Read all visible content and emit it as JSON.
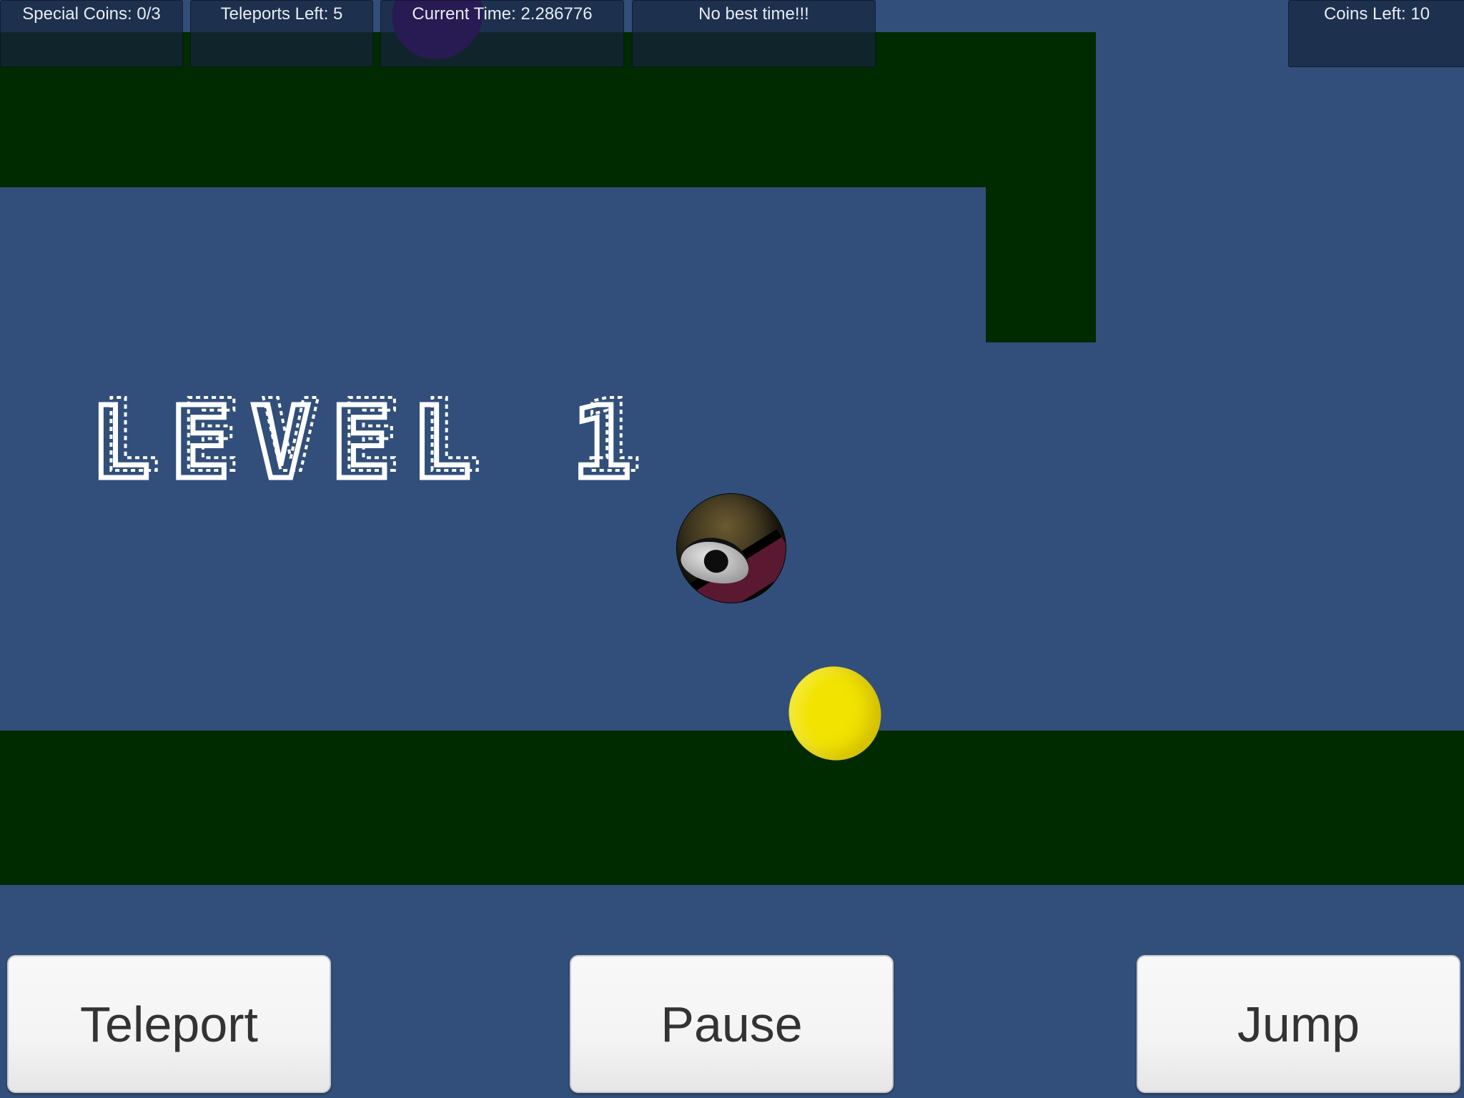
{
  "hud": {
    "special_coins": "Special Coins: 0/3",
    "teleports_left": "Teleports Left: 5",
    "current_time": "Current Time: 2.286776",
    "best_time": "No best time!!!",
    "coins_left": "Coins Left: 10"
  },
  "level_banner": {
    "text": "LEVEL 1"
  },
  "controls": {
    "teleport_label": "Teleport",
    "pause_label": "Pause",
    "jump_label": "Jump"
  },
  "colors": {
    "background": "#314f7a",
    "platform": "#002a00",
    "hud_panel": "rgba(22,36,60,0.72)",
    "hud_text": "#e8ecf2",
    "purple_coin": "#580090",
    "yellow_coin": "#f2e300",
    "player_ball": "#2a2518",
    "button_face": "#f4f4f4",
    "button_text": "#333333",
    "banner_outline": "#ffffff"
  },
  "icons": {
    "player": "eyeball-ball-icon",
    "special_coin": "purple-special-coin-icon",
    "coin": "yellow-coin-icon"
  }
}
